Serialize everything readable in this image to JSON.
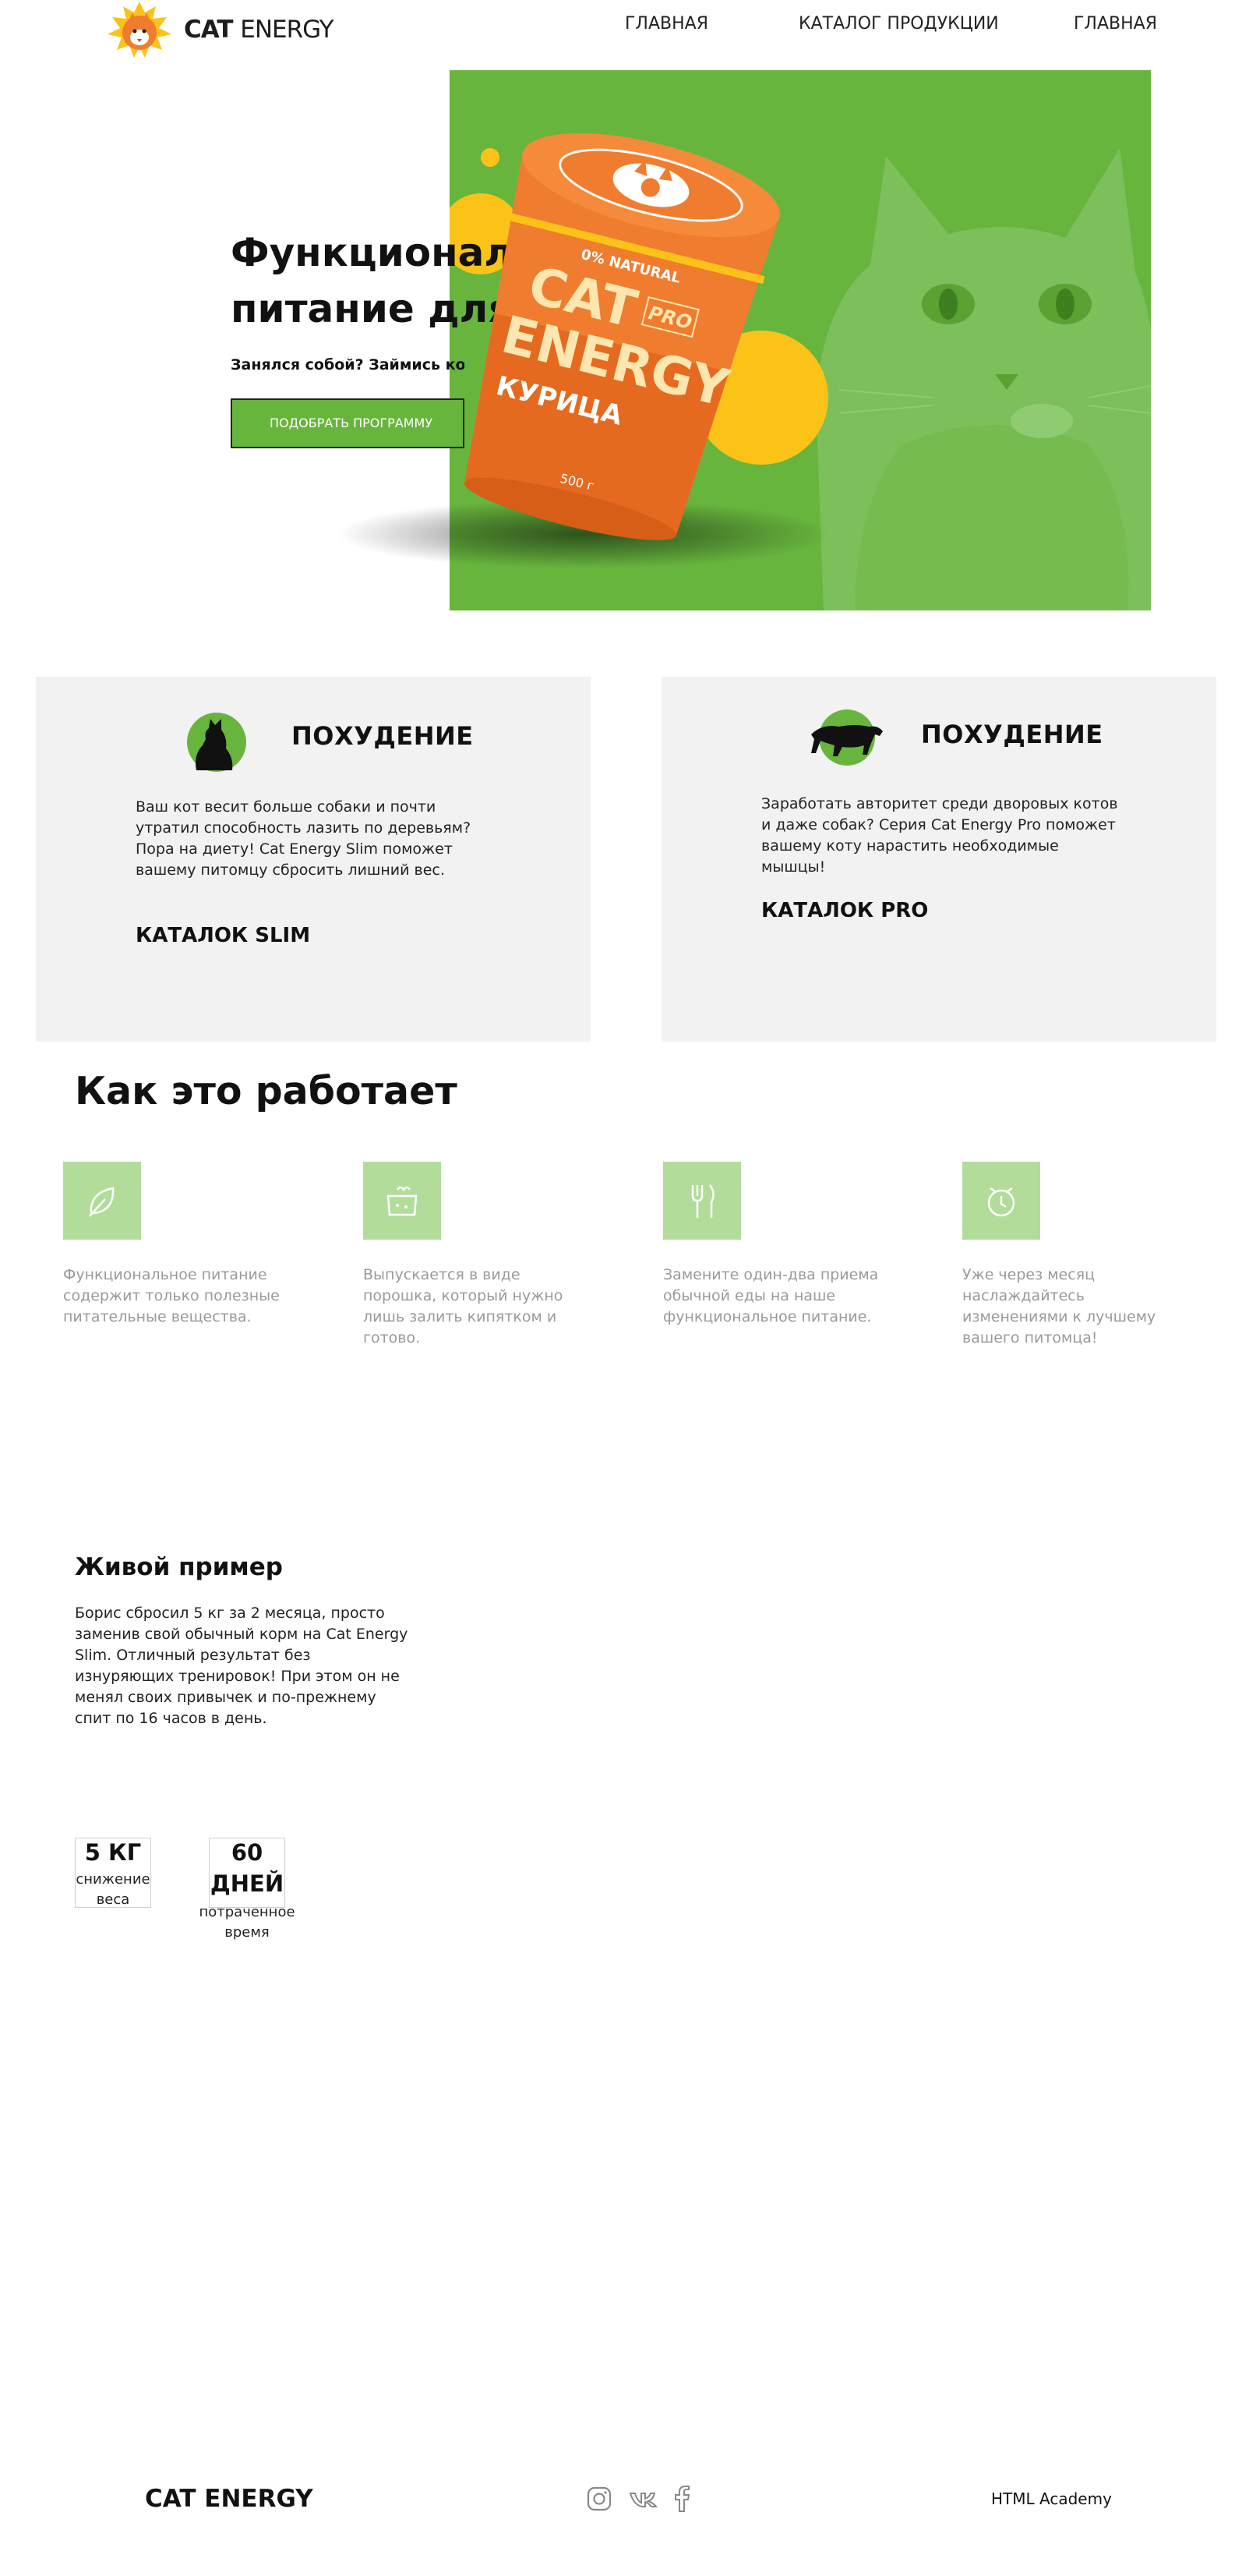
{
  "colors": {
    "accent": "#68b53e",
    "accent_light": "#b2dc9a",
    "card_bg": "#f2f2f2",
    "pack_orange": "#f07c2f",
    "yellow": "#fbc318"
  },
  "header": {
    "logo_bold": "CAT",
    "logo_light": "ENERGY",
    "nav": [
      "ГЛАВНАЯ",
      "КАТАЛОГ ПРОДУКЦИИ",
      "ГЛАВНАЯ"
    ]
  },
  "hero": {
    "title_line1": "Функционал",
    "title_line2": "питание для к",
    "subtitle": "Занялся собой? Займись котом!",
    "button": "ПОДОБРАТЬ ПРОГРАММУ",
    "pack": {
      "natural": "0% NATURAL",
      "brand1": "CAT",
      "brand2": "ENERGY",
      "pro": "PRO",
      "flavor": "КУРИЦА",
      "weight": "500 г"
    }
  },
  "catalog": [
    {
      "icon": "cat-silhouette-icon",
      "title": "ПОХУДЕНИЕ",
      "text": "Ваш кот весит больше собаки и почти утратил способность лазить по деревьям? Пора на диету! Cat Energy Slim поможет вашему питомцу сбросить лишний вес.",
      "link": "КАТАЛОК SLIM"
    },
    {
      "icon": "panther-icon",
      "title": "ПОХУДЕНИЕ",
      "text": "Заработать авторитет среди дворовых котов и даже собак? Серия Cat Energy Pro поможет вашему коту нарастить необходимые мышцы!",
      "link": "КАТАЛОК PRO"
    }
  ],
  "how": {
    "title": "Как это работает",
    "steps": [
      {
        "icon": "leaf-icon",
        "text": "Функциональное питание содержит только полезные питательные вещества."
      },
      {
        "icon": "powder-bowl-icon",
        "text": "Выпускается в виде порошка, который нужно лишь залить кипятком и готово."
      },
      {
        "icon": "fork-knife-icon",
        "text": "Замените один-два приема обычной еды на наше функциональное питание."
      },
      {
        "icon": "alarm-clock-icon",
        "text": "Уже через месяц наслаждайтесь изменениями к лучшему вашего питомца!"
      }
    ]
  },
  "example": {
    "title": "Живой пример",
    "text": "Борис сбросил 5 кг за 2 месяца, просто заменив свой обычный корм на Cat Energy Slim. Отличный результат без изнуряющих тренировок! При этом он не менял своих привычек и по-прежнему спит по 16 часов в день.",
    "stats": [
      {
        "value": "5 КГ",
        "label1": "снижение",
        "label2": "веса"
      },
      {
        "value1": "60",
        "value2": "ДНЕЙ",
        "label1": "потраченное",
        "label2": "время"
      }
    ]
  },
  "footer": {
    "logo": "CAT ENERGY",
    "social": [
      "instagram-icon",
      "vk-icon",
      "facebook-icon"
    ],
    "academy": "HTML Academy"
  }
}
